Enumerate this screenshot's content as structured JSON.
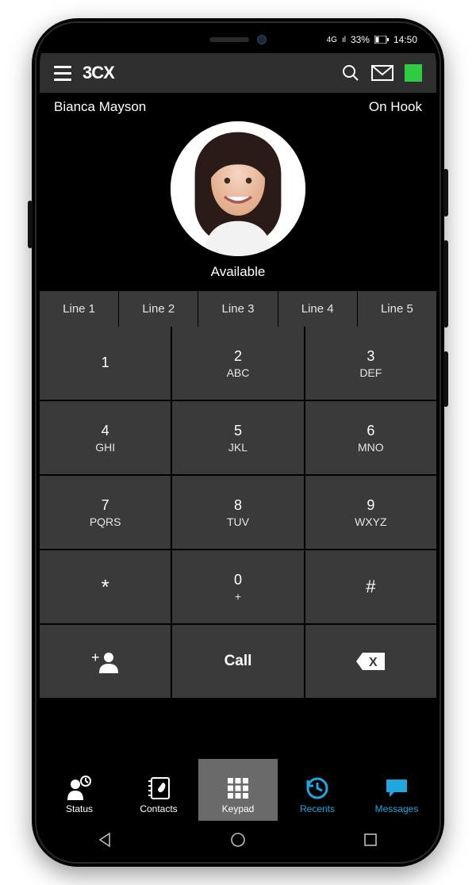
{
  "os_status": {
    "network": "4G",
    "signal": "ıl",
    "battery_pct": "33%",
    "time": "14:50"
  },
  "topbar": {
    "logo": "3CX"
  },
  "user": {
    "name": "Bianca Mayson",
    "hook": "On Hook",
    "presence": "Available"
  },
  "lines": [
    "Line 1",
    "Line 2",
    "Line 3",
    "Line 4",
    "Line 5"
  ],
  "keypad": [
    {
      "num": "1",
      "sub": ""
    },
    {
      "num": "2",
      "sub": "ABC"
    },
    {
      "num": "3",
      "sub": "DEF"
    },
    {
      "num": "4",
      "sub": "GHI"
    },
    {
      "num": "5",
      "sub": "JKL"
    },
    {
      "num": "6",
      "sub": "MNO"
    },
    {
      "num": "7",
      "sub": "PQRS"
    },
    {
      "num": "8",
      "sub": "TUV"
    },
    {
      "num": "9",
      "sub": "WXYZ"
    },
    {
      "num": "*",
      "sub": ""
    },
    {
      "num": "0",
      "sub": "+"
    },
    {
      "num": "#",
      "sub": ""
    }
  ],
  "actions": {
    "call": "Call"
  },
  "nav": {
    "status": "Status",
    "contacts": "Contacts",
    "keypad": "Keypad",
    "recents": "Recents",
    "messages": "Messages"
  }
}
